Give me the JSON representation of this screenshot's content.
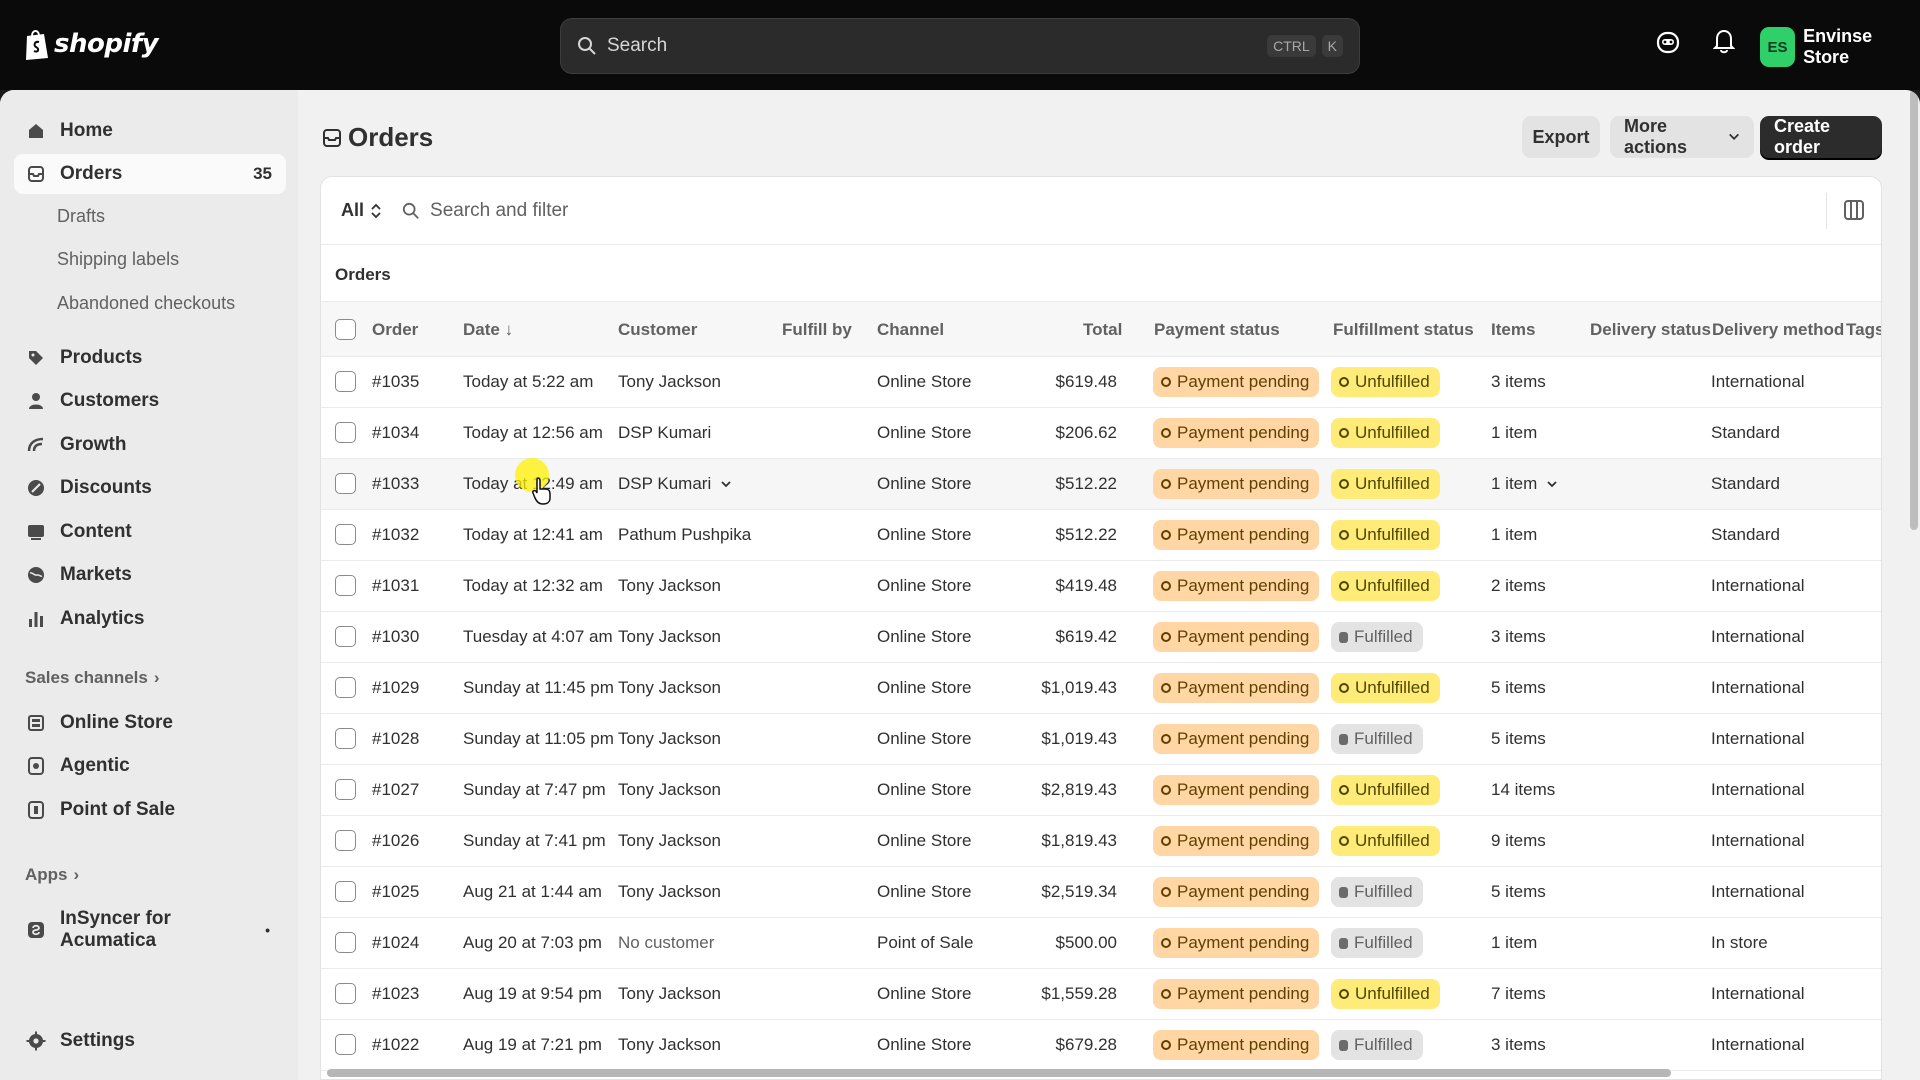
{
  "topbar": {
    "brand": "shopify",
    "search_placeholder": "Search",
    "shortcut_ctrl": "CTRL",
    "shortcut_key": "K",
    "store_initials": "ES",
    "store_name": "Envinse Store"
  },
  "sidebar": {
    "items": [
      {
        "label": "Home",
        "icon": "home-icon"
      },
      {
        "label": "Orders",
        "icon": "orders-icon",
        "count": "35",
        "active": true
      },
      {
        "label": "Products",
        "icon": "tag-icon"
      },
      {
        "label": "Customers",
        "icon": "person-icon"
      },
      {
        "label": "Growth",
        "icon": "growth-icon"
      },
      {
        "label": "Discounts",
        "icon": "discount-icon"
      },
      {
        "label": "Content",
        "icon": "content-icon"
      },
      {
        "label": "Markets",
        "icon": "globe-icon"
      },
      {
        "label": "Analytics",
        "icon": "chart-bar-icon"
      }
    ],
    "order_subitems": [
      "Drafts",
      "Shipping labels",
      "Abandoned checkouts"
    ],
    "sales_channels_label": "Sales channels",
    "channels": [
      {
        "label": "Online Store",
        "icon": "online-store-icon"
      },
      {
        "label": "Agentic",
        "icon": "agentic-icon"
      },
      {
        "label": "Point of Sale",
        "icon": "pos-icon"
      }
    ],
    "apps_label": "Apps",
    "apps": [
      {
        "label": "InSyncer for Acumatica",
        "icon": "app-icon"
      }
    ],
    "settings_label": "Settings"
  },
  "page": {
    "title": "Orders",
    "export_label": "Export",
    "more_actions_label": "More actions",
    "create_order_label": "Create order",
    "filter_all": "All",
    "filter_placeholder": "Search and filter",
    "table_caption": "Orders"
  },
  "table": {
    "headers": {
      "order": "Order",
      "date": "Date",
      "customer": "Customer",
      "fulfill_by": "Fulfill by",
      "channel": "Channel",
      "total": "Total",
      "payment_status": "Payment status",
      "fulfillment_status": "Fulfillment status",
      "items": "Items",
      "delivery_status": "Delivery status",
      "delivery_method": "Delivery method",
      "tags": "Tags"
    },
    "rows": [
      {
        "order": "#1035",
        "date": "Today at 5:22 am",
        "customer": "Tony Jackson",
        "channel": "Online Store",
        "total": "$619.48",
        "payment": "Payment pending",
        "fulfillment": "Unfulfilled",
        "items": "3 items",
        "method": "International"
      },
      {
        "order": "#1034",
        "date": "Today at 12:56 am",
        "customer": "DSP Kumari",
        "channel": "Online Store",
        "total": "$206.62",
        "payment": "Payment pending",
        "fulfillment": "Unfulfilled",
        "items": "1 item",
        "method": "Standard"
      },
      {
        "order": "#1033",
        "date": "Today at 12:49 am",
        "customer": "DSP Kumari",
        "channel": "Online Store",
        "total": "$512.22",
        "payment": "Payment pending",
        "fulfillment": "Unfulfilled",
        "items": "1 item",
        "method": "Standard"
      },
      {
        "order": "#1032",
        "date": "Today at 12:41 am",
        "customer": "Pathum Pushpika",
        "channel": "Online Store",
        "total": "$512.22",
        "payment": "Payment pending",
        "fulfillment": "Unfulfilled",
        "items": "1 item",
        "method": "Standard"
      },
      {
        "order": "#1031",
        "date": "Today at 12:32 am",
        "customer": "Tony Jackson",
        "channel": "Online Store",
        "total": "$419.48",
        "payment": "Payment pending",
        "fulfillment": "Unfulfilled",
        "items": "2 items",
        "method": "International"
      },
      {
        "order": "#1030",
        "date": "Tuesday at 4:07 am",
        "customer": "Tony Jackson",
        "channel": "Online Store",
        "total": "$619.42",
        "payment": "Payment pending",
        "fulfillment": "Fulfilled",
        "items": "3 items",
        "method": "International"
      },
      {
        "order": "#1029",
        "date": "Sunday at 11:45 pm",
        "customer": "Tony Jackson",
        "channel": "Online Store",
        "total": "$1,019.43",
        "payment": "Payment pending",
        "fulfillment": "Unfulfilled",
        "items": "5 items",
        "method": "International"
      },
      {
        "order": "#1028",
        "date": "Sunday at 11:05 pm",
        "customer": "Tony Jackson",
        "channel": "Online Store",
        "total": "$1,019.43",
        "payment": "Payment pending",
        "fulfillment": "Fulfilled",
        "items": "5 items",
        "method": "International"
      },
      {
        "order": "#1027",
        "date": "Sunday at 7:47 pm",
        "customer": "Tony Jackson",
        "channel": "Online Store",
        "total": "$2,819.43",
        "payment": "Payment pending",
        "fulfillment": "Unfulfilled",
        "items": "14 items",
        "method": "International"
      },
      {
        "order": "#1026",
        "date": "Sunday at 7:41 pm",
        "customer": "Tony Jackson",
        "channel": "Online Store",
        "total": "$1,819.43",
        "payment": "Payment pending",
        "fulfillment": "Unfulfilled",
        "items": "9 items",
        "method": "International"
      },
      {
        "order": "#1025",
        "date": "Aug 21 at 1:44 am",
        "customer": "Tony Jackson",
        "channel": "Online Store",
        "total": "$2,519.34",
        "payment": "Payment pending",
        "fulfillment": "Fulfilled",
        "items": "5 items",
        "method": "International"
      },
      {
        "order": "#1024",
        "date": "Aug 20 at 7:03 pm",
        "customer": "No customer",
        "channel": "Point of Sale",
        "total": "$500.00",
        "payment": "Payment pending",
        "fulfillment": "Fulfilled",
        "items": "1 item",
        "method": "In store"
      },
      {
        "order": "#1023",
        "date": "Aug 19 at 9:54 pm",
        "customer": "Tony Jackson",
        "channel": "Online Store",
        "total": "$1,559.28",
        "payment": "Payment pending",
        "fulfillment": "Unfulfilled",
        "items": "7 items",
        "method": "International"
      },
      {
        "order": "#1022",
        "date": "Aug 19 at 7:21 pm",
        "customer": "Tony Jackson",
        "channel": "Online Store",
        "total": "$679.28",
        "payment": "Payment pending",
        "fulfillment": "Fulfilled",
        "items": "3 items",
        "method": "International"
      }
    ]
  },
  "colors": {
    "payment_badge": "#ffd6a4",
    "unfulfilled_badge": "#ffeb78",
    "fulfilled_badge": "#e3e3e3",
    "avatar": "#2fcf6a",
    "primary_button": "#2c2c2c"
  }
}
